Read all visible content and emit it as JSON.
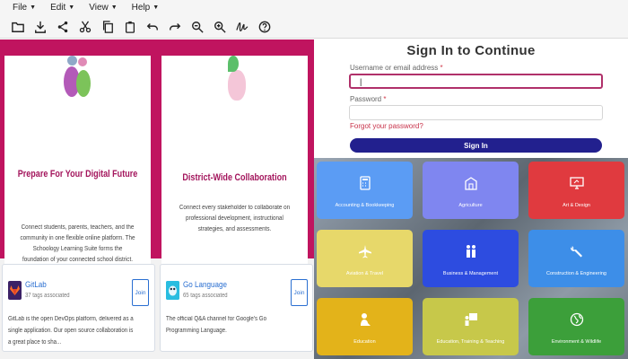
{
  "menu": {
    "file": "File",
    "edit": "Edit",
    "view": "View",
    "help": "Help"
  },
  "toolbar": {
    "icons": [
      "folder-icon",
      "download-icon",
      "share-icon",
      "cut-icon",
      "copy-icon",
      "paste-icon",
      "undo-icon",
      "redo-icon",
      "zoom-out-icon",
      "zoom-in-icon",
      "signature-icon",
      "help-icon"
    ]
  },
  "promo": {
    "card1_title": "Prepare For Your Digital Future",
    "card1_desc": "Connect students, parents, teachers, and the community in one flexible online platform. The Schoology Learning Suite forms the foundation of your connected school district.",
    "card2_title": "District-Wide Collaboration",
    "card2_desc": "Connect every stakeholder to collaborate on professional development, instructional strategies, and assessments."
  },
  "communities": [
    {
      "name": "GitLab",
      "tags": "37 tags associated",
      "join": "Join",
      "desc": "GitLab is the open DevOps platform, delivered as a single application. Our open source collaboration is a great place to sha..."
    },
    {
      "name": "Go Language",
      "tags": "65 tags associated",
      "join": "Join",
      "desc": "The official Q&A channel for Google's Go Programming Language."
    }
  ],
  "signin": {
    "title": "Sign In to Continue",
    "username_label": "Username or email address",
    "username_value": "|",
    "password_label": "Password",
    "required_mark": "*",
    "forgot": "Forgot your password?",
    "button": "Sign In"
  },
  "categories": [
    {
      "label": "Accounting & Bookkeeping",
      "color": "#5b9cf4"
    },
    {
      "label": "Agriculture",
      "color": "#7f86f0"
    },
    {
      "label": "Art & Design",
      "color": "#e03a3f"
    },
    {
      "label": "Aviation & Travel",
      "color": "#e7d86a"
    },
    {
      "label": "Business & Management",
      "color": "#2d4ce0"
    },
    {
      "label": "Construction & Engineering",
      "color": "#3d8ee8"
    },
    {
      "label": "Education",
      "color": "#e3b31a"
    },
    {
      "label": "Education, Training & Teaching",
      "color": "#c7c84a"
    },
    {
      "label": "Environment & Wildlife",
      "color": "#3c9f3a"
    }
  ],
  "colors": {
    "brand_magenta": "#c0145f",
    "signin_button": "#22208e",
    "link_blue": "#2a6fd1"
  }
}
